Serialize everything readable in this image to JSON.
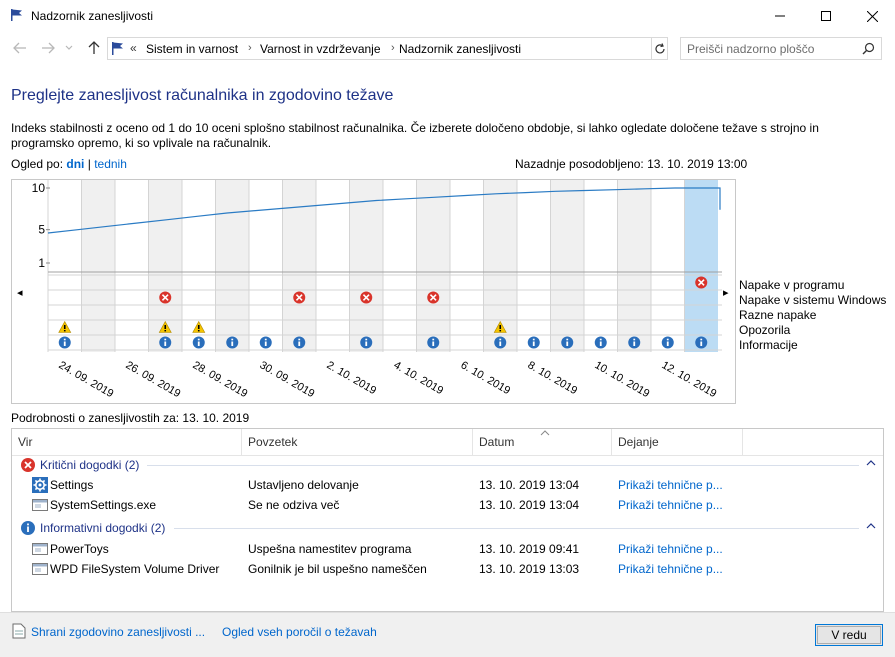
{
  "window": {
    "title": "Nadzornik zanesljivosti"
  },
  "address": {
    "chevron": "«",
    "crumbs": [
      "Sistem in varnost",
      "Varnost in vzdrževanje",
      "Nadzornik zanesljivosti"
    ],
    "separator": "›"
  },
  "search": {
    "placeholder": "Preišči nadzorno ploščo"
  },
  "heading": "Preglejte zanesljivost računalnika in zgodovino težave",
  "description": "Indeks stabilnosti z oceno od 1 do 10 oceni splošno stabilnost računalnika. Če izberete določeno obdobje, si lahko ogledate določene težave s strojno in programsko opremo, ki so vplivale na računalnik.",
  "view_by": {
    "label": "Ogled po:",
    "days": "dni",
    "separator": " | ",
    "weeks": "tednih"
  },
  "last_updated": "Nazadnje posodobljeno: 13. 10. 2019 13:00",
  "chart": {
    "y_ticks": [
      "10",
      "5",
      "1"
    ],
    "date_labels": [
      "24. 09. 2019",
      "26. 09. 2019",
      "28. 09. 2019",
      "30. 09. 2019",
      "2. 10. 2019",
      "4. 10. 2019",
      "6. 10. 2019",
      "8. 10. 2019",
      "10. 10. 2019",
      "12. 10. 2019"
    ],
    "stability_index": [
      4.6,
      5.0,
      5.4,
      5.8,
      6.2,
      6.6,
      7.0,
      7.3,
      7.6,
      7.9,
      8.2,
      8.5,
      8.7,
      8.9,
      9.1,
      9.3,
      9.45,
      9.6,
      9.7,
      9.8,
      9.9,
      10.0,
      10.0
    ],
    "app_failures_cols": [
      19
    ],
    "misc_failures_cols": [
      3,
      7,
      9,
      11
    ],
    "warnings_cols": [
      0,
      3,
      4,
      13
    ],
    "info_cols": [
      0,
      3,
      4,
      5,
      6,
      7,
      9,
      11,
      13,
      14,
      15,
      16,
      17,
      18,
      19
    ],
    "selected_col": 19,
    "arrow_left": "◂",
    "arrow_right": "▸"
  },
  "legend": [
    "Napake v programu",
    "Napake v sistemu Windows",
    "Razne napake",
    "Opozorila",
    "Informacije"
  ],
  "details_label": "Podrobnosti o zanesljivostih za: 13. 10. 2019",
  "table": {
    "columns": [
      "Vir",
      "Povzetek",
      "Datum",
      "Dejanje"
    ],
    "groups": [
      {
        "title": "Kritični dogodki (2)",
        "icon": "error-icon",
        "rows": [
          {
            "icon": "settings-gear-icon",
            "source": "Settings",
            "summary": "Ustavljeno delovanje",
            "date": "13. 10. 2019 13:04",
            "action": "Prikaži tehnične p..."
          },
          {
            "icon": "app-window-icon",
            "source": "SystemSettings.exe",
            "summary": "Se ne odziva več",
            "date": "13. 10. 2019 13:04",
            "action": "Prikaži tehnične p..."
          }
        ]
      },
      {
        "title": "Informativni dogodki (2)",
        "icon": "info-icon",
        "rows": [
          {
            "icon": "app-window-icon",
            "source": "PowerToys",
            "summary": "Uspešna namestitev programa",
            "date": "13. 10. 2019 09:41",
            "action": "Prikaži tehnične p..."
          },
          {
            "icon": "app-window-icon",
            "source": "WPD FileSystem Volume Driver",
            "summary": "Gonilnik je bil uspešno nameščen",
            "date": "13. 10. 2019 13:03",
            "action": "Prikaži tehnične p..."
          }
        ]
      }
    ]
  },
  "footer": {
    "save_link": "Shrani zgodovino zanesljivosti ...",
    "view_reports_link": "Ogled vseh poročil o težavah",
    "ok_button": "V redu"
  }
}
